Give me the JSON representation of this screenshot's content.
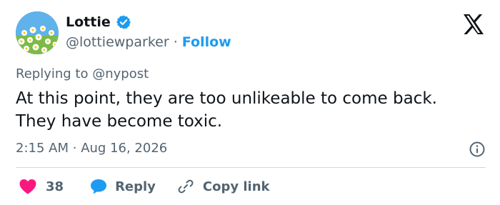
{
  "user": {
    "display_name": "Lottie",
    "handle": "@lottiewparker",
    "separator": "·",
    "follow_label": "Follow"
  },
  "reply_context": {
    "prefix": "Replying to",
    "handle": "@nypost"
  },
  "tweet": {
    "text_line1": "At this point, they are too unlikeable to come back.",
    "text_line2": "They have become toxic.",
    "time": "2:15 AM",
    "separator": "·",
    "date": "Aug 16, 2026"
  },
  "actions": {
    "like_count": "38",
    "reply_label": "Reply",
    "copy_link_label": "Copy link"
  },
  "icons": {
    "avatar": "daisies-avatar",
    "verified": "verified-badge-icon",
    "brand": "x-logo-icon",
    "info": "info-icon",
    "like": "heart-icon",
    "reply": "speech-bubble-icon",
    "copy": "link-icon"
  },
  "colors": {
    "accent": "#1d9bf0",
    "like": "#f91880",
    "muted": "#536471",
    "text": "#0f1419",
    "divider": "#cfd9de"
  }
}
